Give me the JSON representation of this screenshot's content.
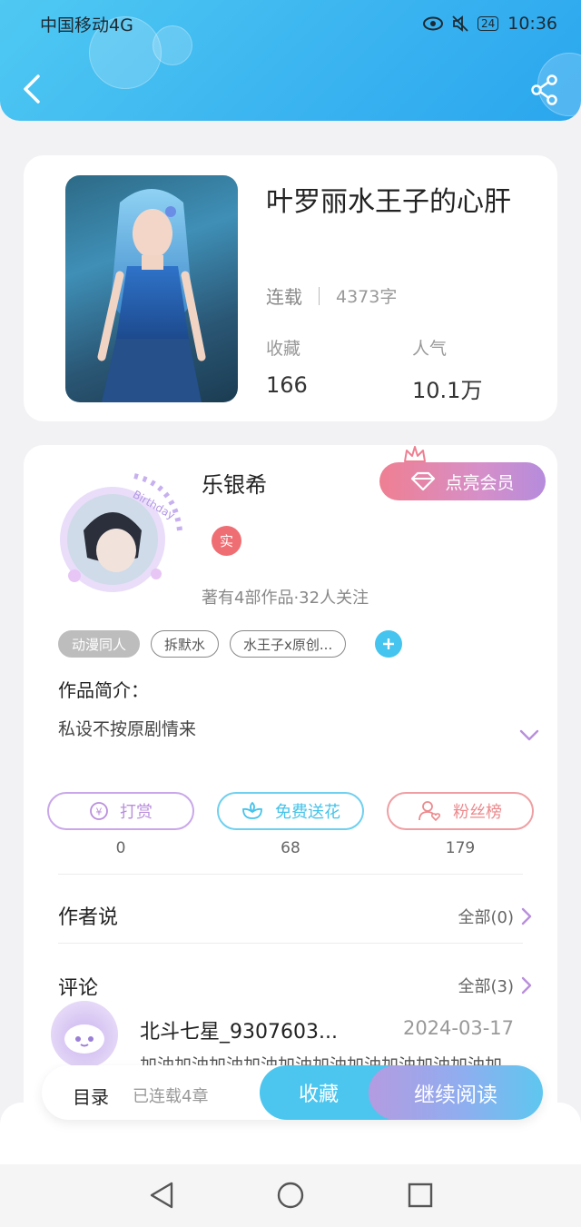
{
  "status_bar": {
    "carrier": "中国移动4G",
    "signal_label": "4G",
    "battery": "24",
    "time": "10:36"
  },
  "header": {
    "back_icon": "chevron-left-icon",
    "share_icon": "share-icon"
  },
  "book": {
    "title": "叶罗丽水王子的心肝",
    "status": "连载",
    "word_count": "4373字",
    "favorites_label": "收藏",
    "favorites_value": "166",
    "popularity_label": "人气",
    "popularity_value": "10.1万"
  },
  "author": {
    "name": "乐银希",
    "vip_button": "点亮会员",
    "real_badge": "实",
    "stats": "著有4部作品·32人关注",
    "tags": [
      "动漫同人",
      "拆默水",
      "水王子x原创..."
    ],
    "intro_label": "作品简介：",
    "intro_text": "私设不按原剧情来"
  },
  "actions": [
    {
      "label": "打赏",
      "count": "0",
      "color": "#b98fdc"
    },
    {
      "label": "免费送花",
      "count": "68",
      "color": "#45c3ea"
    },
    {
      "label": "粉丝榜",
      "count": "179",
      "color": "#ec8a8e"
    }
  ],
  "author_says": {
    "title": "作者说",
    "all_label": "全部(0)"
  },
  "comments": {
    "title": "评论",
    "all_label": "全部(3)",
    "first": {
      "user": "北斗七星_9307603...",
      "date": "2024-03-17",
      "text": "加油加油加油加油加油加油加油加油加油加油加"
    }
  },
  "bottom_bar": {
    "toc_label": "目录",
    "serial_label": "已连载4章",
    "collect_label": "收藏",
    "read_label": "继续阅读"
  },
  "colors": {
    "header_blue": "#3bb4f0",
    "accent_cyan": "#4cc6ee",
    "vip_pink": "#ef7f92"
  }
}
